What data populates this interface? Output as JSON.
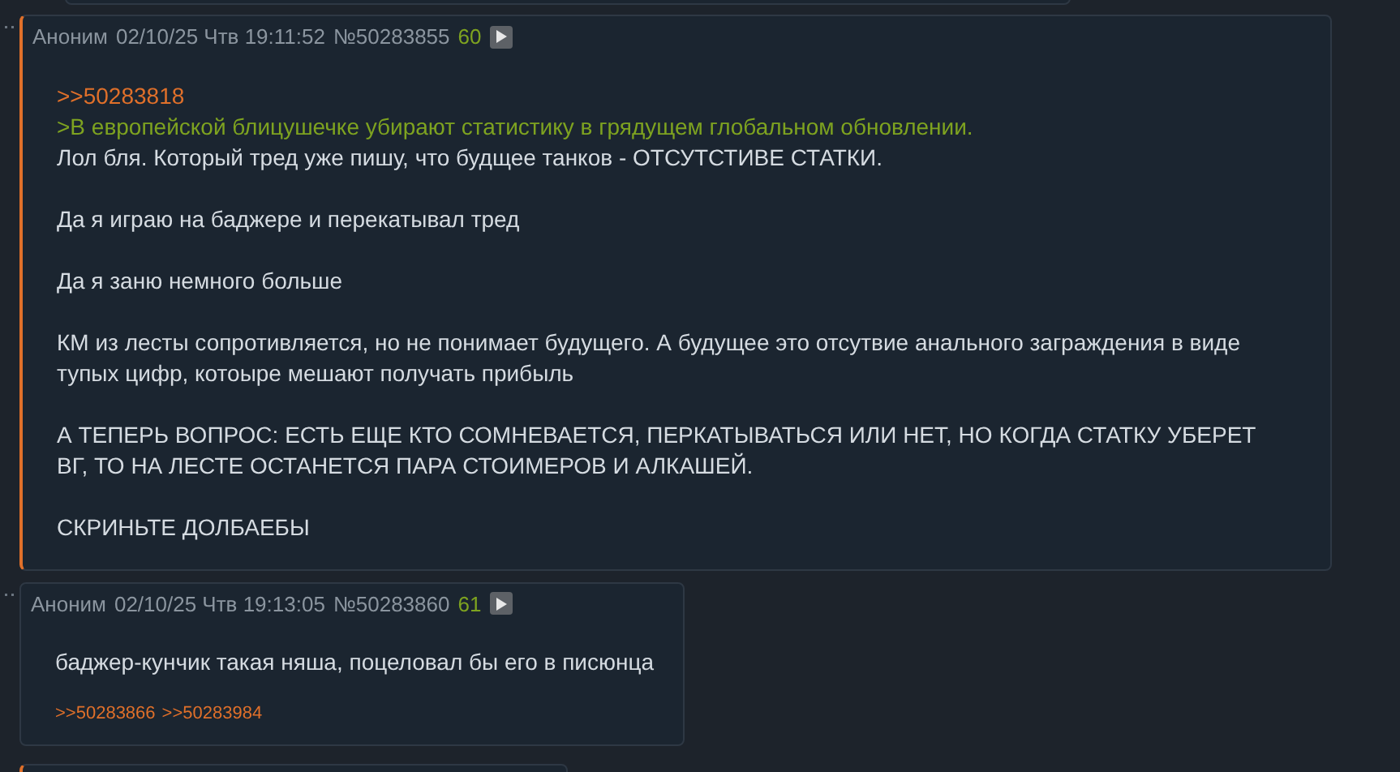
{
  "posts": [
    {
      "author": "Аноним",
      "date": "02/10/25 Чтв 19:11:52",
      "number": "№50283855",
      "index": "60",
      "highlighted": true,
      "paragraphs": [
        [
          {
            "kind": "link",
            "text": ">>50283818"
          },
          {
            "kind": "quote",
            "text": ">В европейской блицушечке убирают статистику в грядущем глобальном обновлении."
          },
          {
            "kind": "text",
            "text": "Лол бля. Который тред уже пишу, что будщее танков - ОТСУТСТИВЕ СТАТКИ."
          }
        ],
        [
          {
            "kind": "text",
            "text": "Да я играю на баджере и перекатывал тред"
          }
        ],
        [
          {
            "kind": "text",
            "text": "Да я заню немного больше"
          }
        ],
        [
          {
            "kind": "text",
            "text": "КМ из лесты сопротивляется, но не понимает будущего. А будущее это отсутвие анального заграждения в виде тупых цифр, котоыре мешают получать прибыль"
          }
        ],
        [
          {
            "kind": "text",
            "text": "А ТЕПЕРЬ ВОПРОС: ЕСТЬ ЕЩЕ КТО СОМНЕВАЕТСЯ, ПЕРКАТЫВАТЬСЯ ИЛИ НЕТ, НО КОГДА СТАТКУ УБЕРЕТ ВГ, ТО НА ЛЕСТЕ ОСТАНЕТСЯ ПАРА СТОИМЕРОВ И АЛКАШЕЙ."
          }
        ],
        [
          {
            "kind": "text",
            "text": "СКРИНЬТЕ ДОЛБАЕБЫ"
          }
        ]
      ]
    },
    {
      "author": "Аноним",
      "date": "02/10/25 Чтв 19:13:05",
      "number": "№50283860",
      "index": "61",
      "highlighted": false,
      "paragraphs": [
        [
          {
            "kind": "text",
            "text": "баджер-кунчик такая няша, поцеловал бы его в писюнца"
          }
        ]
      ],
      "replies": [
        ">>50283866",
        ">>50283984"
      ]
    }
  ]
}
